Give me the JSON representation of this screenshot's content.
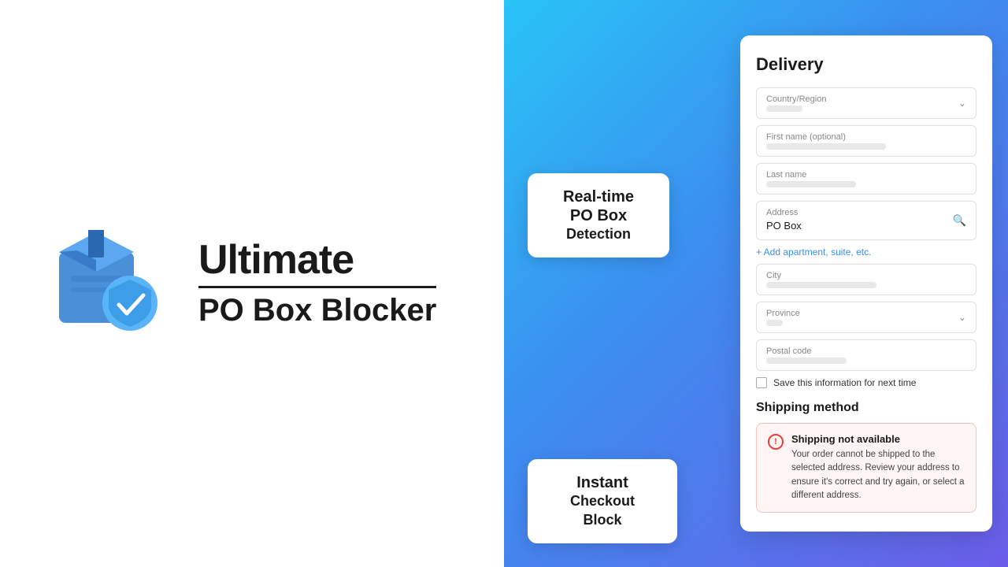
{
  "brand": {
    "title": "Ultimate",
    "subtitle": "PO Box Blocker"
  },
  "feature_badges": {
    "realtime": {
      "line1": "Real-time",
      "line2": "PO Box",
      "line3": "Detection"
    },
    "instant": {
      "line1": "Instant",
      "line2": "Checkout Block"
    }
  },
  "checkout": {
    "title": "Delivery",
    "fields": {
      "country": "Country/Region",
      "first_name": "First name (optional)",
      "last_name": "Last name",
      "address": "Address",
      "address_value": "PO Box",
      "add_apt": "+ Add apartment, suite, etc.",
      "city": "City",
      "province": "Province",
      "postal_code": "Postal code",
      "save_label": "Save this information for next time"
    },
    "shipping_method_title": "Shipping method",
    "error": {
      "title": "Shipping not available",
      "description": "Your order cannot be shipped to the selected address. Review your address to ensure it's correct and try again, or select a different address."
    }
  },
  "icons": {
    "search": "🔍",
    "chevron_down": "∨",
    "exclamation": "!",
    "checkbox": ""
  }
}
